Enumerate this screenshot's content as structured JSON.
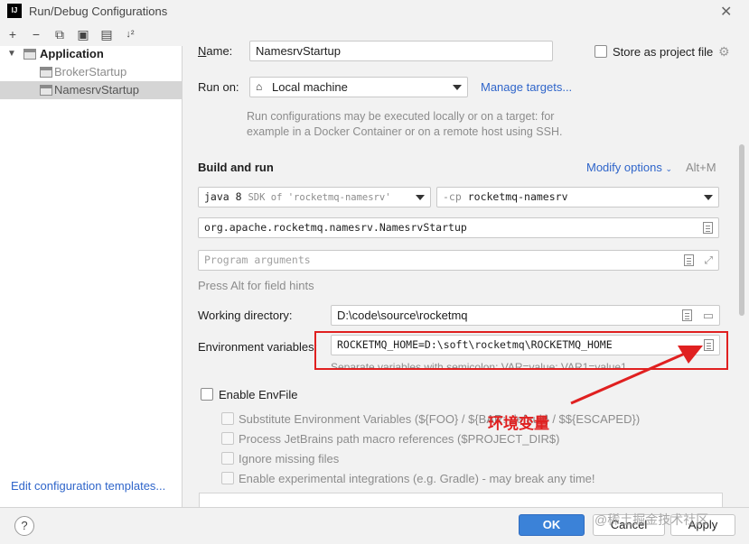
{
  "window": {
    "title": "Run/Debug Configurations",
    "logo": "IJ"
  },
  "toolbar": {
    "icons": [
      "add-icon",
      "remove-icon",
      "copy-icon",
      "save-icon",
      "folder-add-icon",
      "sort-icon"
    ],
    "glyphs": [
      "+",
      "−",
      "⧉",
      "▣",
      "▤",
      "↓²"
    ]
  },
  "tree": {
    "root": "Application",
    "items": [
      {
        "label": "BrokerStartup",
        "selected": false
      },
      {
        "label": "NamesrvStartup",
        "selected": true
      }
    ]
  },
  "sidebar": {
    "edit_templates": "Edit configuration templates..."
  },
  "form": {
    "name_label": "Name:",
    "name_value": "NamesrvStartup",
    "store_label": "Store as project file",
    "run_on_label": "Run on:",
    "run_on_value": "Local machine",
    "manage_targets": "Manage targets...",
    "run_on_hint_1": "Run configurations may be executed locally or on a target: for",
    "run_on_hint_2": "example in a Docker Container or on a remote host using SSH.",
    "build_and_run": "Build and run",
    "modify_options": "Modify options",
    "modify_shortcut": "Alt+M",
    "sdk_value": "java 8",
    "sdk_detail": "SDK of 'rocketmq-namesrv'",
    "cp_prefix": "-cp",
    "cp_value": "rocketmq-namesrv",
    "main_class": "org.apache.rocketmq.namesrv.NamesrvStartup",
    "program_args_placeholder": "Program arguments",
    "alt_hint": "Press Alt for field hints",
    "working_dir_label": "Working directory:",
    "working_dir_value": "D:\\code\\source\\rocketmq",
    "env_label": "Environment variables:",
    "env_value": "ROCKETMQ_HOME=D:\\soft\\rocketmq\\ROCKETMQ_HOME",
    "env_hint": "Separate variables with semicolon: VAR=value; VAR1=value1",
    "enable_envfile": "Enable EnvFile",
    "envfile_options": [
      "Substitute Environment Variables (${FOO} / ${BAR:-default} / $${ESCAPED})",
      "Process JetBrains path macro references ($PROJECT_DIR$)",
      "Ignore missing files",
      "Enable experimental integrations (e.g. Gradle) - may break any time!"
    ]
  },
  "annotation": {
    "text": "环境变量",
    "color": "#e02020"
  },
  "buttons": {
    "ok": "OK",
    "cancel": "Cancel",
    "apply": "Apply",
    "help": "?"
  },
  "watermark": "@稀土掘金技术社区",
  "colors": {
    "accent": "#3b82d8",
    "link": "#2f65ca",
    "selection": "#d5d5d5"
  }
}
